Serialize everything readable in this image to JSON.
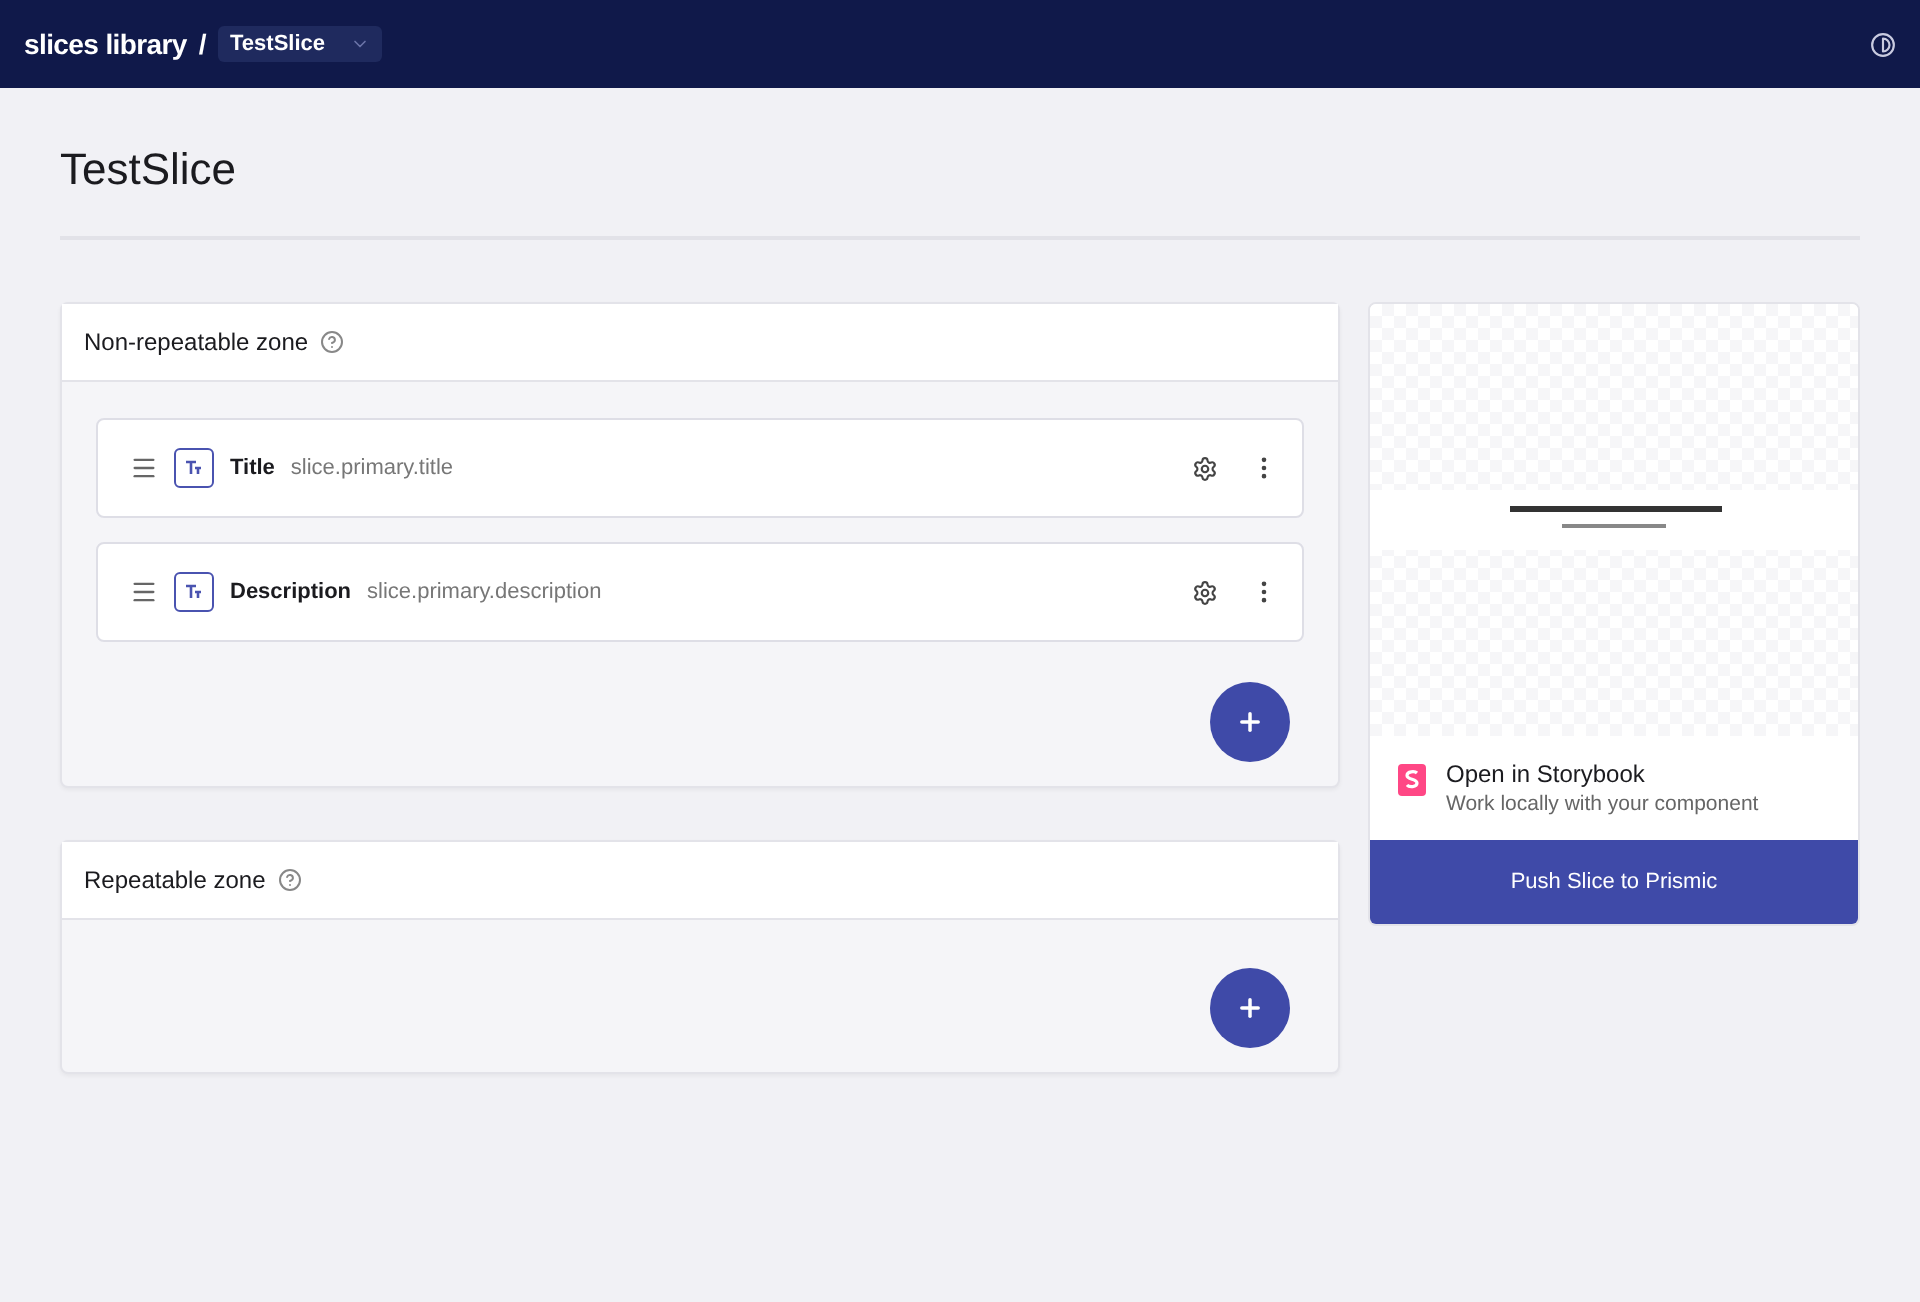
{
  "header": {
    "breadcrumb": "slices library",
    "separator": "/",
    "slice_select": "TestSlice"
  },
  "title": "TestSlice",
  "zones": [
    {
      "title": "Non-repeatable zone",
      "fields": [
        {
          "label": "Title",
          "path": "slice.primary.title"
        },
        {
          "label": "Description",
          "path": "slice.primary.description"
        }
      ]
    },
    {
      "title": "Repeatable zone"
    }
  ],
  "side_panel": {
    "storybook_title": "Open in Storybook",
    "storybook_subtitle": "Work locally with your component",
    "push_button": "Push Slice to Prismic"
  }
}
